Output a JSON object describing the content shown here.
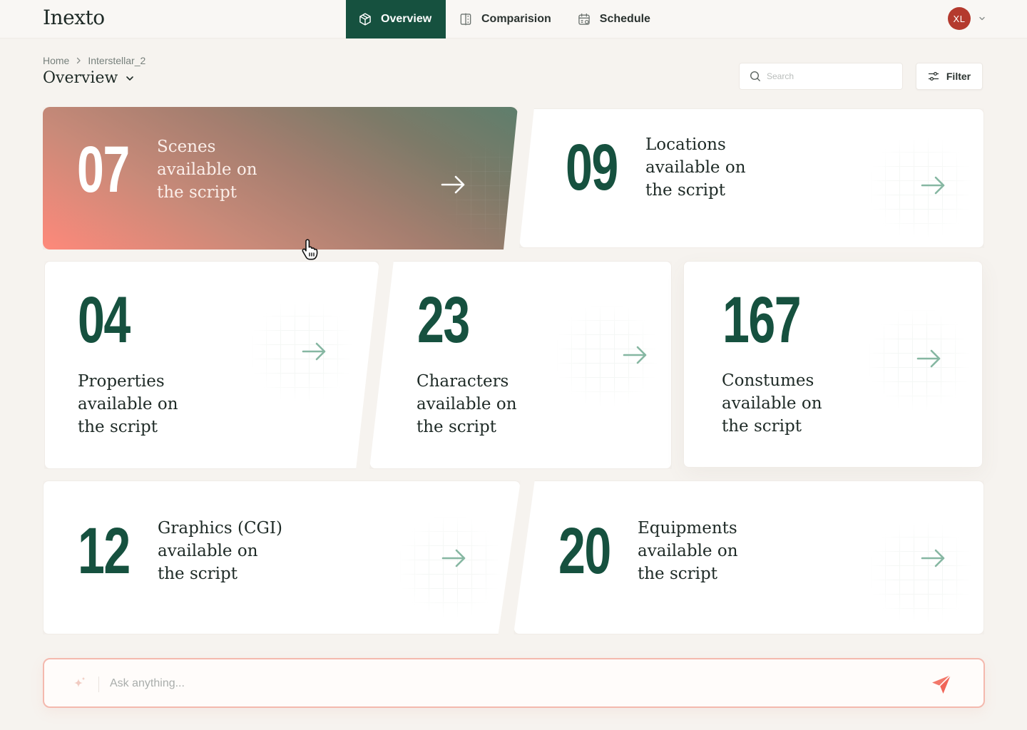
{
  "app": {
    "logo": "Inexto"
  },
  "nav": {
    "items": [
      {
        "label": "Overview",
        "icon": "cube-icon",
        "active": true
      },
      {
        "label": "Comparision",
        "icon": "split-view-icon",
        "active": false
      },
      {
        "label": "Schedule",
        "icon": "calendar-icon",
        "active": false
      }
    ]
  },
  "user": {
    "initials": "XL",
    "avatar_color": "#b43a2e"
  },
  "breadcrumb": {
    "home": "Home",
    "current": "Interstellar_2"
  },
  "page": {
    "title": "Overview"
  },
  "search": {
    "placeholder": "Search",
    "value": ""
  },
  "filter": {
    "label": "Filter"
  },
  "cards": [
    {
      "key": "scenes",
      "number": "07",
      "line1": "Scenes",
      "line2": "available on",
      "line3": "the script",
      "featured": true
    },
    {
      "key": "locations",
      "number": "09",
      "line1": "Locations",
      "line2": "available on",
      "line3": "the script",
      "featured": false
    },
    {
      "key": "properties",
      "number": "04",
      "line1": "Properties",
      "line2": "available on",
      "line3": "the script",
      "featured": false
    },
    {
      "key": "characters",
      "number": "23",
      "line1": "Characters",
      "line2": "available on",
      "line3": "the script",
      "featured": false
    },
    {
      "key": "costumes",
      "number": "167",
      "line1": "Constumes",
      "line2": "available on",
      "line3": "the script",
      "featured": false
    },
    {
      "key": "graphics",
      "number": "12",
      "line1": "Graphics (CGI)",
      "line2": "available on",
      "line3": "the script",
      "featured": false
    },
    {
      "key": "equipments",
      "number": "20",
      "line1": "Equipments",
      "line2": "available on",
      "line3": "the script",
      "featured": false
    }
  ],
  "ask": {
    "placeholder": "Ask anything...",
    "value": ""
  },
  "colors": {
    "brand": "#16513f",
    "accent": "#fe897a",
    "arrow": "#86b7a2",
    "background": "#f6f3ef"
  }
}
